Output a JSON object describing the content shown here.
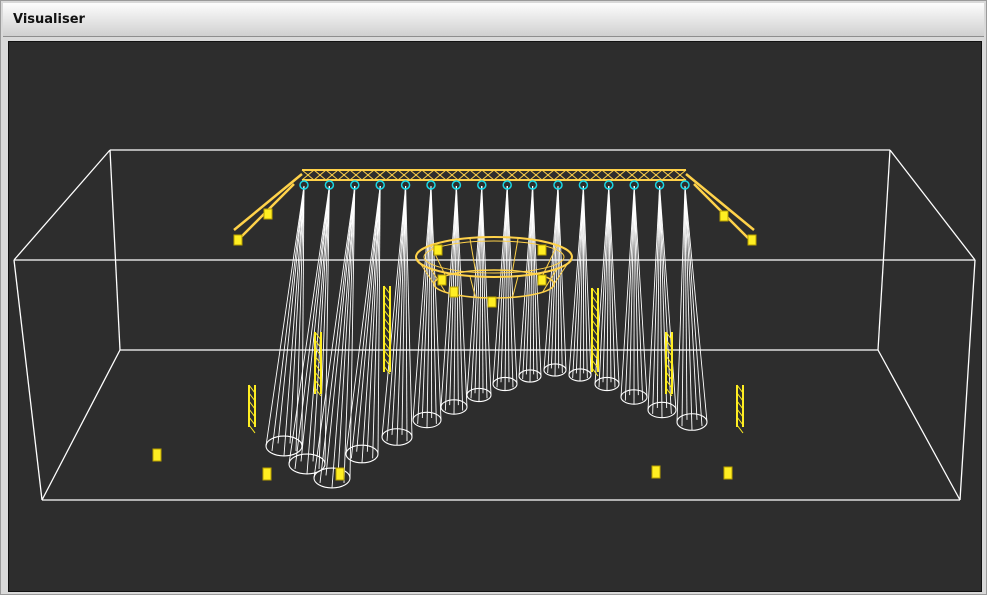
{
  "window": {
    "title": "Visualiser"
  },
  "scene": {
    "background_color": "#2d2d2d",
    "room_wire_color": "#ffffff",
    "truss_color": "#ffd24a",
    "fixture_color": "#ffee22",
    "fixture_lens_color": "#1ad7e6",
    "beam_color": "#ffffff",
    "rear_truss_fixture_count": 16,
    "beam_count": 16,
    "circular_truss_count": 1,
    "floor_fixture_count": 5,
    "vertical_truss_count": 6
  }
}
